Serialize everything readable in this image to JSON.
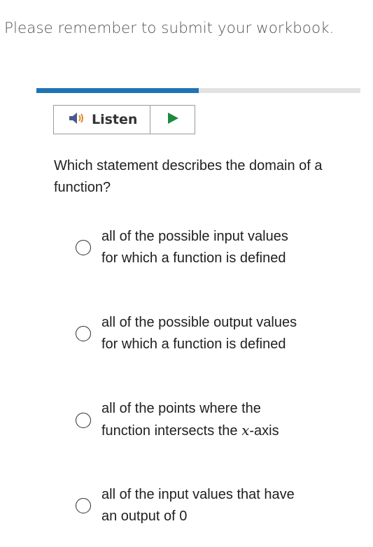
{
  "banner": {
    "text": "Please remember to submit your workbook."
  },
  "progress": {
    "fraction": 0.5
  },
  "listen": {
    "label": "Listen"
  },
  "question": {
    "text": "Which statement describes the domain of a function?"
  },
  "options": [
    {
      "text": "all of the possible input values for which a function is defined"
    },
    {
      "text": "all of the possible output values for which a function is defined"
    },
    {
      "text_before": "all of the points where the function intersects the ",
      "math": "x",
      "text_after": "-axis"
    },
    {
      "text": "all of the input values that have an output of 0"
    }
  ],
  "colors": {
    "progress_fill": "#1f74b4",
    "progress_track": "#e3e3e3",
    "play_icon": "#1f8a3d",
    "speaker_icon": "#4a5a8a"
  }
}
